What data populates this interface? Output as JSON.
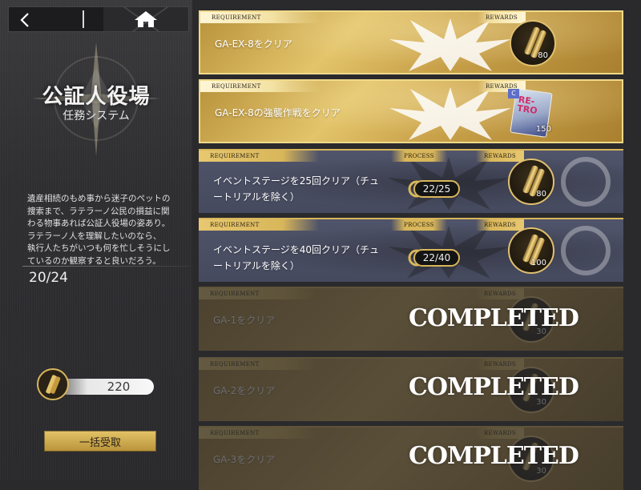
{
  "panel": {
    "title": "公証人役場",
    "subtitle": "任務システム",
    "description": "遺産相続のもめ事から迷子のペットの\n捜索まで、ラテラーノ公民の損益に関\nわる物事あれば公証人役場の姿あり。\nラテラーノ人を理解したいのなら、\n執行人たちがいつも何を忙しそうにし\nているのか観察すると良いだろう。",
    "progress": "20/24",
    "currency_amount": "220",
    "bulk_claim_label": "一括受取"
  },
  "icons": {
    "back": "chevron-left-icon",
    "home": "home-icon",
    "currency": "ammo-cartridge-icon"
  },
  "labels": {
    "requirement": "REQUIREMENT",
    "rewards": "REWARDS",
    "process": "PROCESS",
    "completed": "COMPLETED"
  },
  "missions": [
    {
      "text": "GA-EX-8をクリア",
      "state": "claimable",
      "reward_qty": "80",
      "reward_type": "cartridge"
    },
    {
      "text": "GA-EX-8の強襲作戦をクリア",
      "state": "claimable",
      "reward_qty": "150",
      "reward_type": "card",
      "reward_card_text": "RE-TRO",
      "reward_tag": "C"
    },
    {
      "text": "イベントステージを25回クリア（チュートリアルを除く）",
      "state": "in_progress",
      "progress": "22/25",
      "reward_qty": "80",
      "reward_type": "cartridge"
    },
    {
      "text": "イベントステージを40回クリア（チュートリアルを除く）",
      "state": "in_progress",
      "progress": "22/40",
      "reward_qty": "100",
      "reward_type": "cartridge"
    },
    {
      "text": "GA-1をクリア",
      "state": "completed",
      "reward_qty": "30",
      "reward_type": "cartridge"
    },
    {
      "text": "GA-2をクリア",
      "state": "completed",
      "reward_qty": "30",
      "reward_type": "cartridge"
    },
    {
      "text": "GA-3をクリア",
      "state": "completed",
      "reward_qty": "30",
      "reward_type": "cartridge"
    }
  ],
  "colors": {
    "gold": "#e3c46a",
    "gold_border": "#f0d98a",
    "dark_card": "#4b4f63",
    "accent": "#d8b65a"
  }
}
